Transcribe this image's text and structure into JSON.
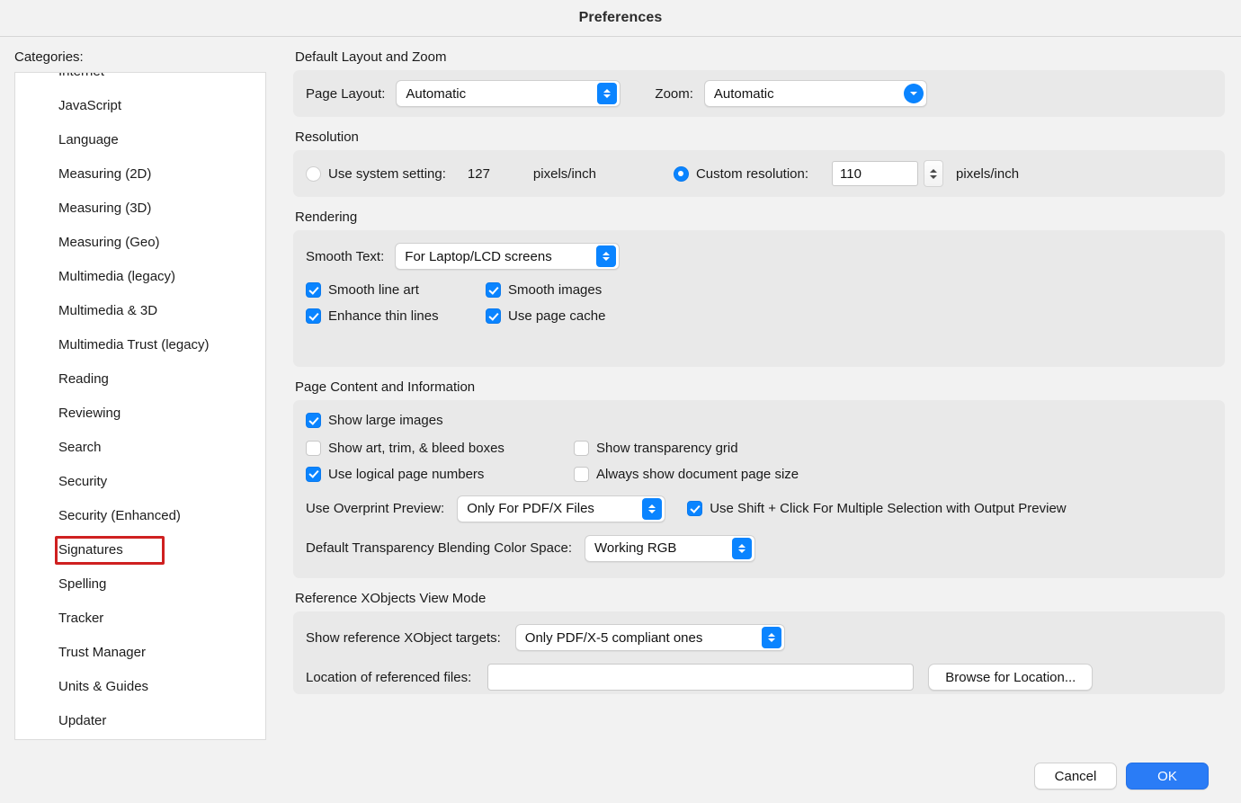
{
  "window": {
    "title": "Preferences"
  },
  "sidebar": {
    "label": "Categories:",
    "items": [
      {
        "label": "Internet",
        "clipped": true
      },
      {
        "label": "JavaScript"
      },
      {
        "label": "Language"
      },
      {
        "label": "Measuring (2D)"
      },
      {
        "label": "Measuring (3D)"
      },
      {
        "label": "Measuring (Geo)"
      },
      {
        "label": "Multimedia (legacy)"
      },
      {
        "label": "Multimedia & 3D"
      },
      {
        "label": "Multimedia Trust (legacy)"
      },
      {
        "label": "Reading"
      },
      {
        "label": "Reviewing"
      },
      {
        "label": "Search"
      },
      {
        "label": "Security"
      },
      {
        "label": "Security (Enhanced)"
      },
      {
        "label": "Signatures",
        "highlighted": true
      },
      {
        "label": "Spelling"
      },
      {
        "label": "Tracker"
      },
      {
        "label": "Trust Manager"
      },
      {
        "label": "Units & Guides"
      },
      {
        "label": "Updater"
      }
    ],
    "highlight_color": "#cf2020"
  },
  "layout_group": {
    "title": "Default Layout and Zoom",
    "page_layout_label": "Page Layout:",
    "page_layout_value": "Automatic",
    "zoom_label": "Zoom:",
    "zoom_value": "Automatic"
  },
  "resolution_group": {
    "title": "Resolution",
    "system_label": "Use system setting:",
    "system_value": "127",
    "system_unit": "pixels/inch",
    "system_selected": false,
    "custom_label": "Custom resolution:",
    "custom_value": "110",
    "custom_unit": "pixels/inch",
    "custom_selected": true
  },
  "rendering_group": {
    "title": "Rendering",
    "smooth_text_label": "Smooth Text:",
    "smooth_text_value": "For Laptop/LCD screens",
    "checkboxes": [
      {
        "label": "Smooth line art",
        "checked": true
      },
      {
        "label": "Smooth images",
        "checked": true
      },
      {
        "label": "Enhance thin lines",
        "checked": true
      },
      {
        "label": "Use page cache",
        "checked": true
      }
    ]
  },
  "page_content_group": {
    "title": "Page Content and Information",
    "checkboxes": [
      {
        "label": "Show large images",
        "checked": true
      },
      {
        "label": "Show art, trim, & bleed boxes",
        "checked": false
      },
      {
        "label": "Show transparency grid",
        "checked": false
      },
      {
        "label": "Use logical page numbers",
        "checked": true
      },
      {
        "label": "Always show document page size",
        "checked": false
      }
    ],
    "overprint_label": "Use Overprint Preview:",
    "overprint_value": "Only For PDF/X Files",
    "shift_click_label": "Use Shift + Click For Multiple Selection with Output Preview",
    "shift_click_checked": true,
    "blending_label": "Default Transparency Blending Color Space:",
    "blending_value": "Working RGB"
  },
  "xobjects_group": {
    "title": "Reference XObjects View Mode",
    "targets_label": "Show reference XObject targets:",
    "targets_value": "Only PDF/X-5 compliant ones",
    "location_label": "Location of referenced files:",
    "location_value": "",
    "browse_label": "Browse for Location..."
  },
  "footer": {
    "cancel_label": "Cancel",
    "ok_label": "OK",
    "accent_color": "#2a7cf6"
  }
}
